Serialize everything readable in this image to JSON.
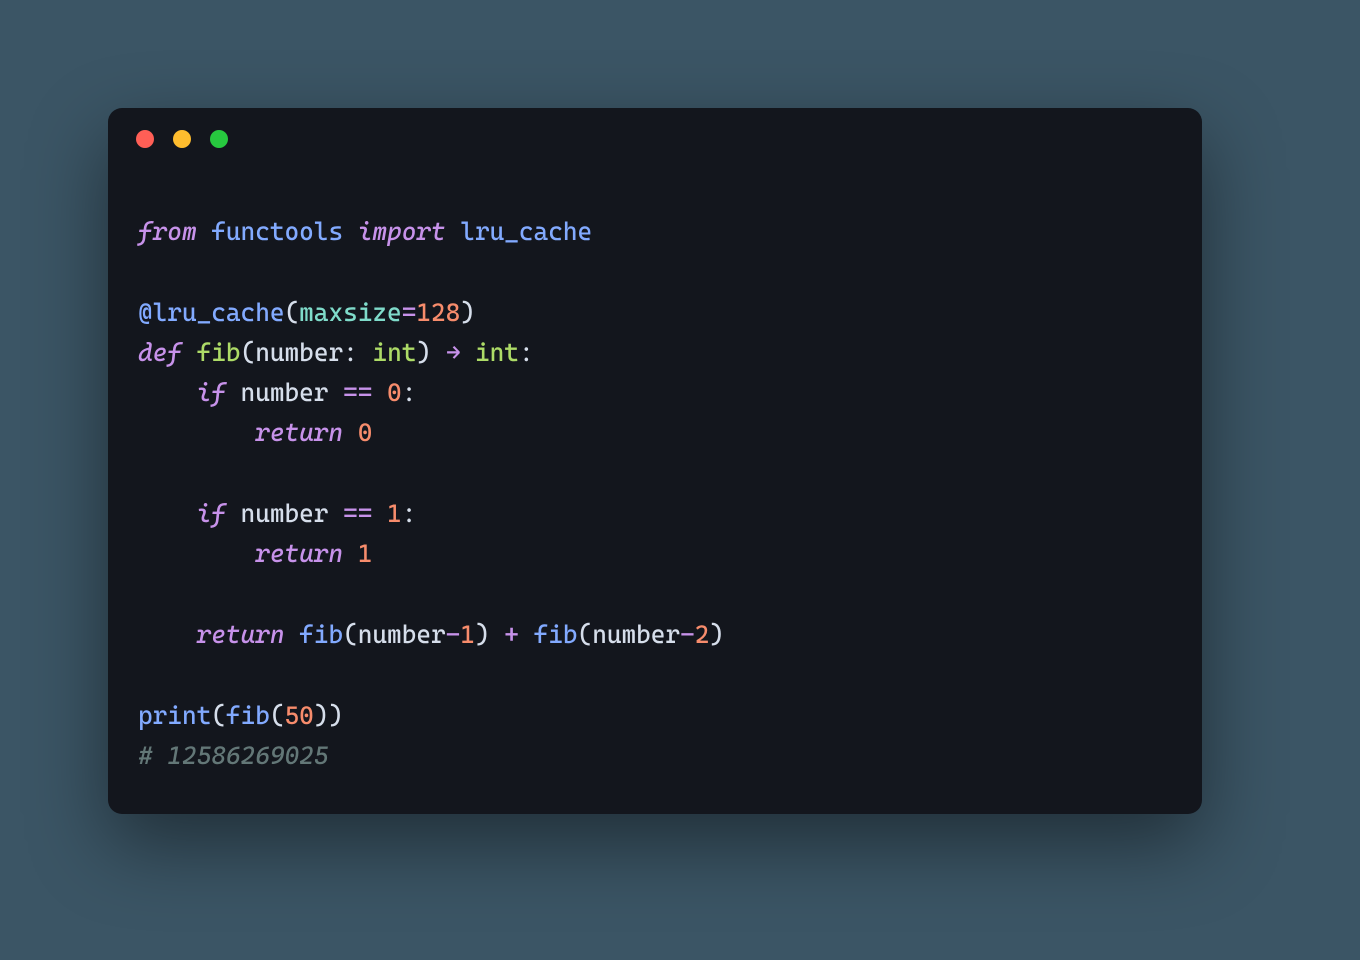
{
  "window": {
    "buttons": {
      "close": "close",
      "minimize": "minimize",
      "zoom": "zoom"
    }
  },
  "syntax": {
    "kw_from": "from",
    "mod_functools": "functools",
    "kw_import": "import",
    "mod_lru_cache": "lru_cache",
    "decor_at": "@",
    "decor_name": "lru_cache",
    "param_maxsize": "maxsize",
    "op_eq_assign": "=",
    "num_128": "128",
    "kw_def": "def",
    "fn_def_fib": "fib",
    "param_number": "number",
    "colon": ":",
    "type_int": "int",
    "arrow": "→",
    "kw_if": "if",
    "op_eq_eq": "==",
    "num_0": "0",
    "num_1": "1",
    "num_2": "2",
    "kw_return": "return",
    "fn_fib_call": "fib",
    "op_minus": "-",
    "op_plus": "+",
    "fn_print": "print",
    "num_50": "50",
    "comment_hash": "#",
    "comment_text": " 12586269025"
  },
  "code_plain": "from functools import lru_cache\n\n@lru_cache(maxsize=128)\ndef fib(number: int) -> int:\n    if number == 0:\n        return 0\n\n    if number == 1:\n        return 1\n\n    return fib(number-1) + fib(number-2)\n\nprint(fib(50))\n# 12586269025"
}
